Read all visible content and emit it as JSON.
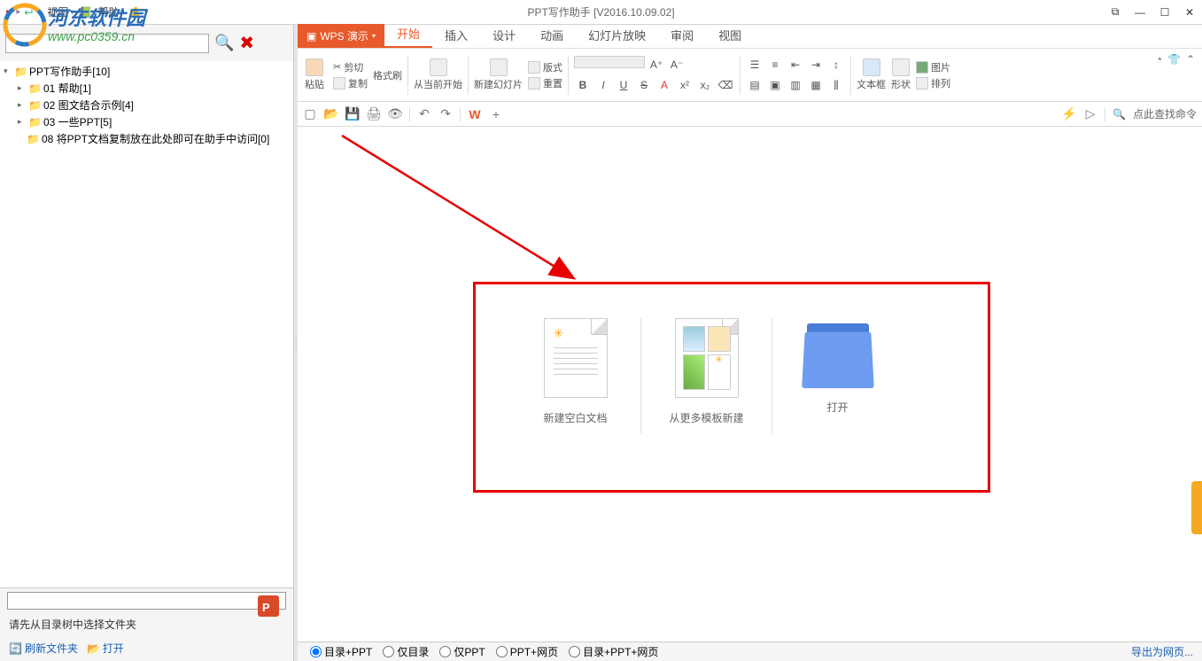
{
  "title": "PPT写作助手 [V2016.10.09.02]",
  "top_menus": {
    "view": "视图",
    "help": "帮助"
  },
  "tree": {
    "root": "PPT写作助手[10]",
    "items": [
      "01 帮助[1]",
      "02 图文结合示例[4]",
      "03 一些PPT[5]",
      "08 将PPT文档复制放在此处即可在助手中访问[0]"
    ]
  },
  "hint_text": "请先从目录树中选择文件夹",
  "bottom_left": {
    "refresh": "刷新文件夹",
    "open": "打开"
  },
  "wps": {
    "brand": "WPS 演示",
    "tabs": [
      "开始",
      "插入",
      "设计",
      "动画",
      "幻灯片放映",
      "审阅",
      "视图"
    ],
    "active_tab": 0,
    "ribbon": {
      "paste": "粘贴",
      "cut": "剪切",
      "copy": "复制",
      "format_painter": "格式刷",
      "from_current": "从当前开始",
      "new_slide": "新建幻灯片",
      "layout": "版式",
      "reset": "重置",
      "textbox": "文本框",
      "shape": "形状",
      "arrange": "排列",
      "picture": "图片"
    },
    "search_placeholder": "点此查找命令"
  },
  "start_options": {
    "blank": "新建空白文档",
    "template": "从更多模板新建",
    "open": "打开"
  },
  "status": {
    "radios": [
      "目录+PPT",
      "仅目录",
      "仅PPT",
      "PPT+网页",
      "目录+PPT+网页"
    ],
    "selected": 0,
    "export": "导出为网页..."
  },
  "watermark": {
    "name": "河东软件园",
    "url": "www.pc0359.cn"
  }
}
